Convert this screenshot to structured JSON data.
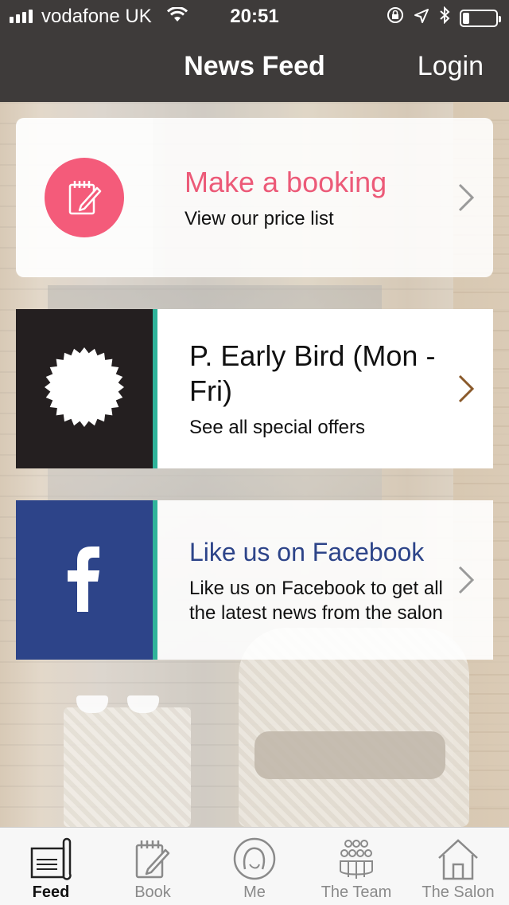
{
  "status_bar": {
    "carrier": "vodafone UK",
    "time": "20:51",
    "battery_level": 0.2
  },
  "nav": {
    "title": "News Feed",
    "login_label": "Login"
  },
  "cards": {
    "booking": {
      "title": "Make a booking",
      "subtitle": "View our price list",
      "icon": "notepad-pencil-icon",
      "accent_color": "#f45b7a"
    },
    "offer": {
      "title": "P. Early Bird (Mon - Fri)",
      "subtitle": "See all special offers",
      "icon": "starburst-badge-icon",
      "chevron_color": "#8a5a2b"
    },
    "facebook": {
      "title": "Like us on Facebook",
      "subtitle": "Like us on Facebook to get all the latest news from the salon",
      "icon": "facebook-icon",
      "brand_color": "#2d4489"
    }
  },
  "tabs": [
    {
      "label": "Feed",
      "icon": "feed-scroll-icon",
      "active": true
    },
    {
      "label": "Book",
      "icon": "notepad-pencil-icon",
      "active": false
    },
    {
      "label": "Me",
      "icon": "person-head-icon",
      "active": false
    },
    {
      "label": "The Team",
      "icon": "group-icon",
      "active": false
    },
    {
      "label": "The Salon",
      "icon": "house-icon",
      "active": false
    }
  ],
  "colors": {
    "bar_background": "#3e3b3a",
    "divider_accent": "#2fb39a"
  }
}
